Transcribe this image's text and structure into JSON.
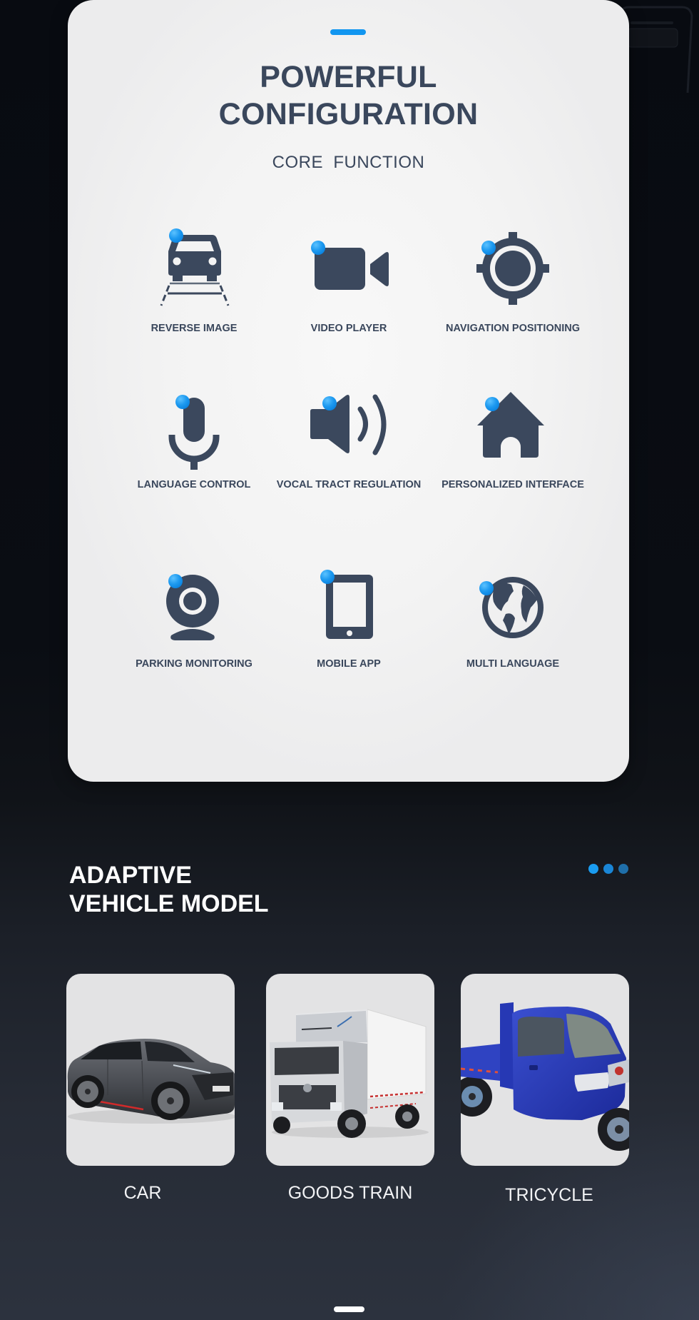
{
  "config": {
    "title_line1": "POWERFUL",
    "title_line2": "CONFIGURATION",
    "subtitle": "CORE  FUNCTION",
    "features": [
      {
        "label": "REVERSE IMAGE",
        "icon": "reverse-camera-car-icon"
      },
      {
        "label": "VIDEO PLAYER",
        "icon": "video-camera-icon"
      },
      {
        "label": "NAVIGATION POSITIONING",
        "icon": "gps-target-icon"
      },
      {
        "label": "LANGUAGE CONTROL",
        "icon": "microphone-icon"
      },
      {
        "label": "VOCAL TRACT REGULATION",
        "icon": "speaker-volume-icon"
      },
      {
        "label": "PERSONALIZED INTERFACE",
        "icon": "home-icon"
      },
      {
        "label": "PARKING MONITORING",
        "icon": "webcam-icon"
      },
      {
        "label": "MOBILE APP",
        "icon": "tablet-icon"
      },
      {
        "label": "MULTI LANGUAGE",
        "icon": "globe-icon"
      }
    ]
  },
  "vehicles_section": {
    "title_line1": "ADAPTIVE",
    "title_line2": "VEHICLE MODEL",
    "pagination": {
      "count": 3
    },
    "vehicles": [
      {
        "label": "CAR",
        "image": "suv-car-image"
      },
      {
        "label": "GOODS TRAIN",
        "image": "box-truck-image"
      },
      {
        "label": "TRICYCLE",
        "image": "blue-cargo-tricycle-image"
      }
    ]
  },
  "colors": {
    "accent": "#1296f0",
    "icon": "#3b485d",
    "text_dark": "#3a475c",
    "card_bg": "#f3f3f3",
    "page_bg_top": "#0a0d13",
    "page_bg_bottom": "#2c323e",
    "pager_dots": [
      "#1a9cf0",
      "#1a86d6",
      "#1f6fa9"
    ]
  }
}
